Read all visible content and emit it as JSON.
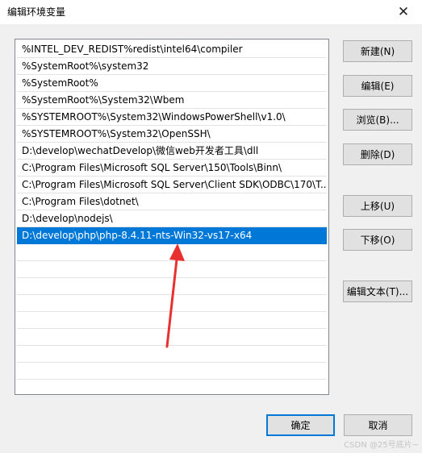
{
  "window": {
    "title": "编辑环境变量",
    "close_label": "✕"
  },
  "path_list": {
    "items": [
      "%INTEL_DEV_REDIST%redist\\intel64\\compiler",
      "%SystemRoot%\\system32",
      "%SystemRoot%",
      "%SystemRoot%\\System32\\Wbem",
      "%SYSTEMROOT%\\System32\\WindowsPowerShell\\v1.0\\",
      "%SYSTEMROOT%\\System32\\OpenSSH\\",
      "D:\\develop\\wechatDevelop\\微信web开发者工具\\dll",
      "C:\\Program Files\\Microsoft SQL Server\\150\\Tools\\Binn\\",
      "C:\\Program Files\\Microsoft SQL Server\\Client SDK\\ODBC\\170\\T...",
      "C:\\Program Files\\dotnet\\",
      "D:\\develop\\nodejs\\",
      "D:\\develop\\php\\php-8.4.11-nts-Win32-vs17-x64"
    ],
    "selected_index": 11,
    "empty_rows": 9
  },
  "buttons": {
    "new": "新建(N)",
    "edit": "编辑(E)",
    "browse": "浏览(B)...",
    "delete": "删除(D)",
    "move_up": "上移(U)",
    "move_down": "下移(O)",
    "edit_text": "编辑文本(T)..."
  },
  "footer": {
    "ok": "确定",
    "cancel": "取消"
  },
  "watermark": "CSDN @25号底片~",
  "colors": {
    "selection": "#0078d7",
    "annotation_arrow": "#e8312f"
  }
}
